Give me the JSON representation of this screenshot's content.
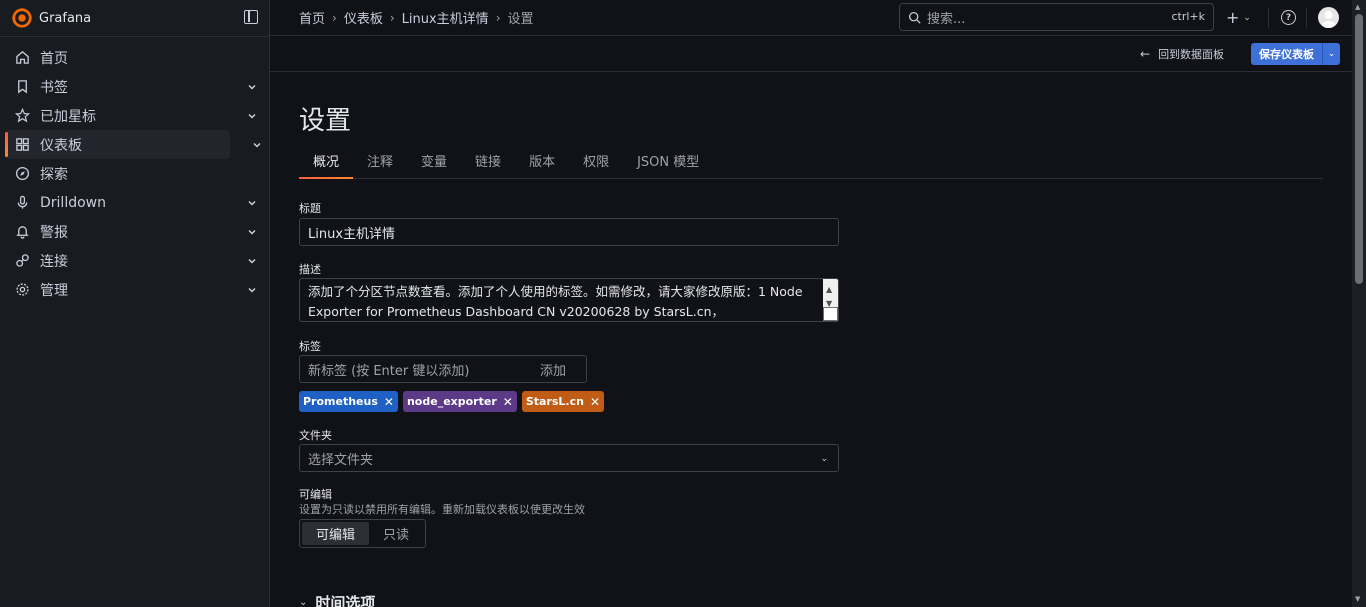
{
  "app": {
    "name": "Grafana"
  },
  "sidebar": {
    "items": [
      {
        "label": "首页",
        "icon": "home-icon",
        "has_chevron": false
      },
      {
        "label": "书签",
        "icon": "bookmark-icon",
        "has_chevron": true
      },
      {
        "label": "已加星标",
        "icon": "star-icon",
        "has_chevron": true
      },
      {
        "label": "仪表板",
        "icon": "dashboards-icon",
        "has_chevron": true,
        "active": true
      },
      {
        "label": "探索",
        "icon": "compass-icon",
        "has_chevron": false
      },
      {
        "label": "Drilldown",
        "icon": "microphone-icon",
        "has_chevron": true
      },
      {
        "label": "警报",
        "icon": "bell-icon",
        "has_chevron": true
      },
      {
        "label": "连接",
        "icon": "link-icon",
        "has_chevron": true
      },
      {
        "label": "管理",
        "icon": "gear-icon",
        "has_chevron": true
      }
    ]
  },
  "topbar": {
    "breadcrumbs": [
      "首页",
      "仪表板",
      "Linux主机详情",
      "设置"
    ],
    "search": {
      "placeholder": "搜索...",
      "shortcut": "ctrl+k"
    },
    "plus": "+"
  },
  "subbar": {
    "back_label": "回到数据面板",
    "save_label": "保存仪表板"
  },
  "page": {
    "title": "设置",
    "tabs": [
      "概况",
      "注释",
      "变量",
      "链接",
      "版本",
      "权限",
      "JSON 模型"
    ],
    "active_tab": "概况"
  },
  "form": {
    "title_label": "标题",
    "title_value": "Linux主机详情",
    "description_label": "描述",
    "description_value": "添加了个分区节点数查看。添加了个人使用的标签。如需修改，请大家修改原版：1 Node Exporter for Prometheus Dashboard CN v20200628 by StarsL.cn，",
    "tags_label": "标签",
    "tag_placeholder": "新标签 (按 Enter 键以添加)",
    "tag_add": "添加",
    "tags": [
      {
        "text": "Prometheus",
        "color": "#1f60c4"
      },
      {
        "text": "node_exporter",
        "color": "#5d3a87"
      },
      {
        "text": "StarsL.cn",
        "color": "#c15c17"
      }
    ],
    "folder_label": "文件夹",
    "folder_placeholder": "选择文件夹",
    "editable_label": "可编辑",
    "editable_hint": "设置为只读以禁用所有编辑。重新加载仪表板以使更改生效",
    "editable_options": [
      "可编辑",
      "只读"
    ],
    "editable_selected": "可编辑"
  },
  "section": {
    "time_options": "时间选项"
  },
  "colors": {
    "primary": "#3d71d9",
    "accent": "#f55f3e",
    "bg": "#111217",
    "sidebar": "#181b1f"
  }
}
